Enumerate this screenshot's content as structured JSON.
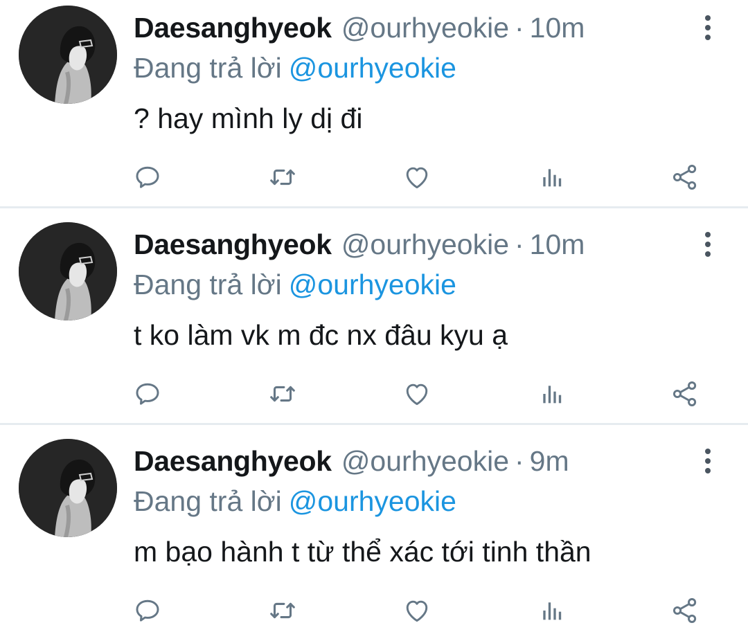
{
  "tweets": [
    {
      "display_name": "Daesanghyeok",
      "handle": "@ourhyeokie",
      "separator": "·",
      "time": "10m",
      "replying_label": "Đang trả lời",
      "replying_to": "@ourhyeokie",
      "text": "? hay mình ly dị đi"
    },
    {
      "display_name": "Daesanghyeok",
      "handle": "@ourhyeokie",
      "separator": "·",
      "time": "10m",
      "replying_label": "Đang trả lời",
      "replying_to": "@ourhyeokie",
      "text": "t ko làm vk m đc nx đâu kyu ạ"
    },
    {
      "display_name": "Daesanghyeok",
      "handle": "@ourhyeokie",
      "separator": "·",
      "time": "9m",
      "replying_label": "Đang trả lời",
      "replying_to": "@ourhyeokie",
      "text": "m bạo hành t từ thể xác tới tinh thần"
    }
  ],
  "icons": {
    "reply": "reply-icon",
    "retweet": "retweet-icon",
    "like": "heart-icon",
    "stats": "analytics-icon",
    "share": "share-icon",
    "more": "more-vertical-icon"
  },
  "colors": {
    "text_primary": "#14171a",
    "text_secondary": "#657786",
    "mention": "#1b95e0",
    "icon": "#657786",
    "divider": "#e6ecf0"
  }
}
